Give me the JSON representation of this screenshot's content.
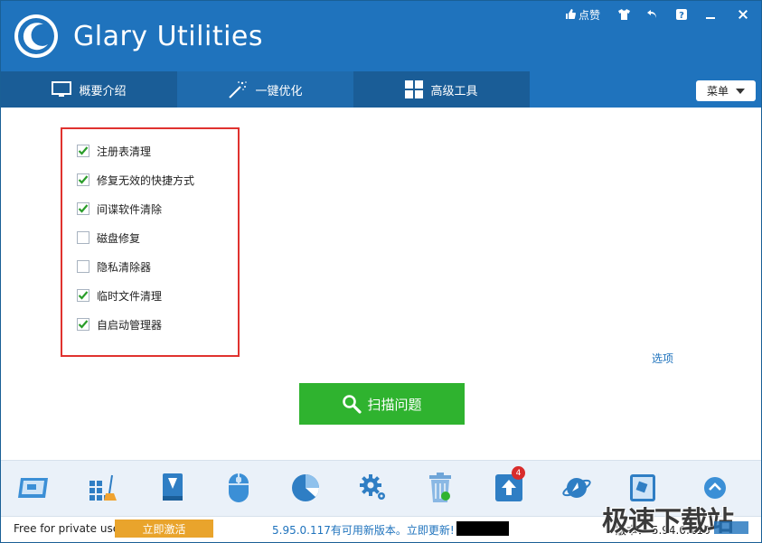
{
  "app": {
    "title": "Glary Utilities"
  },
  "titlebar": {
    "like_label": "点赞"
  },
  "nav": {
    "tabs": [
      {
        "label": "概要介绍"
      },
      {
        "label": "一键优化"
      },
      {
        "label": "高级工具"
      }
    ],
    "menu_label": "菜单"
  },
  "options": [
    {
      "label": "注册表清理",
      "checked": true
    },
    {
      "label": "修复无效的快捷方式",
      "checked": true
    },
    {
      "label": "间谍软件清除",
      "checked": true
    },
    {
      "label": "磁盘修复",
      "checked": false
    },
    {
      "label": "隐私清除器",
      "checked": false
    },
    {
      "label": "临时文件清理",
      "checked": true
    },
    {
      "label": "自启动管理器",
      "checked": true
    }
  ],
  "options_link": "选项",
  "scan_button": "扫描问题",
  "toolbar": {
    "update_badge": "4"
  },
  "status": {
    "free_text": "Free for private use",
    "activate_label": "立即激活",
    "update_text": "5.95.0.117有可用新版本。立即更新!",
    "version_text": "版本：  5.94.0.116"
  },
  "watermark": "极速下载站",
  "colors": {
    "accent": "#1f73bd",
    "scan": "#2fb32f",
    "activate": "#e9a42c",
    "highlight_box": "#e0322f"
  }
}
